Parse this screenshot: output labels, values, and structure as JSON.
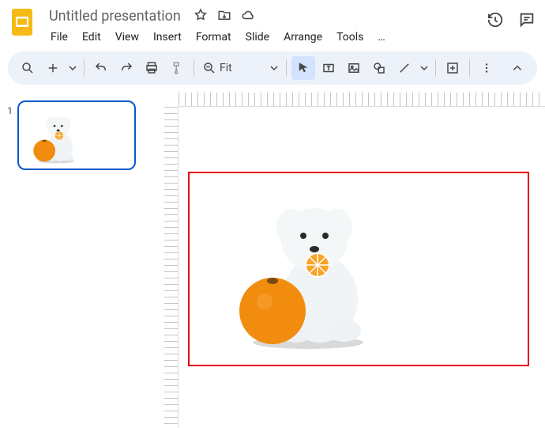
{
  "doc": {
    "title": "Untitled presentation"
  },
  "menus": [
    "File",
    "Edit",
    "View",
    "Insert",
    "Format",
    "Slide",
    "Arrange",
    "Tools",
    "…"
  ],
  "toolbar": {
    "zoom_label": "Fit"
  },
  "filmstrip": {
    "slides": [
      {
        "number": "1"
      }
    ]
  }
}
